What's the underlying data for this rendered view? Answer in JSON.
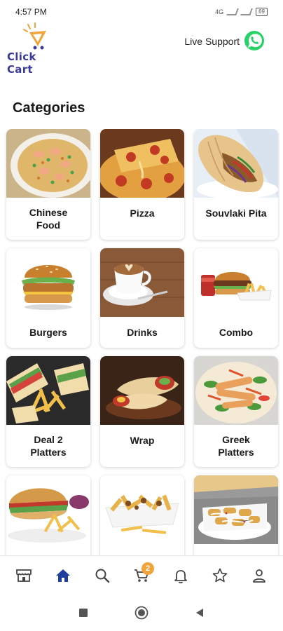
{
  "status_bar": {
    "time": "4:57 PM",
    "network": "4G",
    "battery": "69"
  },
  "app": {
    "name": "Click Cart"
  },
  "header": {
    "support_label": "Live Support",
    "support_icon": "whatsapp-icon"
  },
  "categories": {
    "title": "Categories",
    "items": [
      {
        "label": "Chinese\nFood"
      },
      {
        "label": "Pizza"
      },
      {
        "label": "Souvlaki Pita"
      },
      {
        "label": "Burgers"
      },
      {
        "label": "Drinks"
      },
      {
        "label": "Combo"
      },
      {
        "label": "Deal 2\nPlatters"
      },
      {
        "label": "Wrap"
      },
      {
        "label": "Greek\nPlatters"
      },
      {
        "label": ""
      },
      {
        "label": ""
      },
      {
        "label": ""
      }
    ]
  },
  "bottom_nav": {
    "items": [
      "store-icon",
      "home-icon",
      "search-icon",
      "cart-icon",
      "bell-icon",
      "star-icon",
      "profile-icon"
    ],
    "active": "home-icon",
    "cart_count": "2",
    "active_color": "#1f3f9e",
    "badge_color": "#f0a43a"
  },
  "colors": {
    "brand": "#3a3a9a",
    "whatsapp": "#25d366"
  }
}
